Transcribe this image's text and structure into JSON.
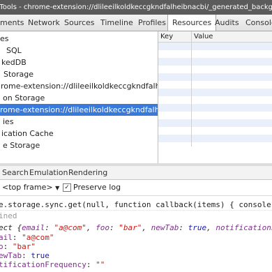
{
  "window": {
    "title": "r Tools - chrome-extension://dlileeilkoldkeccgkndfalheibnacbi/_generated_background_page.html"
  },
  "tabs": [
    {
      "label": "ments",
      "selected": false
    },
    {
      "label": "Network",
      "selected": false
    },
    {
      "label": "Sources",
      "selected": false
    },
    {
      "label": "Timeline",
      "selected": false
    },
    {
      "label": "Profiles",
      "selected": false
    },
    {
      "label": "Resources",
      "selected": true
    },
    {
      "label": "Audits",
      "selected": false
    },
    {
      "label": "Console",
      "selected": false
    }
  ],
  "sidebar": {
    "items": [
      {
        "label": "es",
        "selected": false
      },
      {
        "label": "SQL",
        "selected": false
      },
      {
        "label": "kedDB",
        "selected": false
      },
      {
        "label": "Storage",
        "selected": false
      },
      {
        "label": "rome-extension://dlileeilkoldkeccgkndfalheibn...",
        "selected": false
      },
      {
        "label": "on Storage",
        "selected": false
      },
      {
        "label": "rome-extension://dlileeilkoldkeccgkndfalheibn...",
        "selected": true
      },
      {
        "label": "ies",
        "selected": false
      },
      {
        "label": "ication Cache",
        "selected": false
      },
      {
        "label": "e Storage",
        "selected": false
      }
    ]
  },
  "kv_table": {
    "key_header": "Key",
    "value_header": "Value",
    "refresh_icon": "refresh-icon"
  },
  "drawer": {
    "tabs": [
      {
        "label": "Search"
      },
      {
        "label": "Emulation"
      },
      {
        "label": "Rendering"
      }
    ]
  },
  "console_toolbar": {
    "frame_select": "<top frame>",
    "dropdown_glyph": "▼",
    "preserve_log_label": "Preserve log",
    "preserve_log_checked": true,
    "check_glyph": "✓"
  },
  "console": {
    "command": "e.storage.sync.get(null, function callback(items) { console.log(ite",
    "undefined_result": "ined",
    "object_summary": {
      "open": "ect {",
      "p1_key": "email",
      "p1_colon": ": ",
      "p1_val": "\"a@com\"",
      "sep1": ", ",
      "p2_key": "foo",
      "p2_colon": ": ",
      "p2_val": "\"bar\"",
      "sep2": ", ",
      "p3_key": "newTab",
      "p3_colon": ": ",
      "p3_val": "true",
      "sep3": ", ",
      "p4_key": "notificationFrequency"
    },
    "props": [
      {
        "key": "ail",
        "colon": ": ",
        "value": "\"a@com\"",
        "type": "str"
      },
      {
        "key": "o",
        "colon": ": ",
        "value": "\"bar\"",
        "type": "str"
      },
      {
        "key": "ewTab",
        "colon": ": ",
        "value": "true",
        "type": "kw"
      },
      {
        "key": "tificationFrequency",
        "colon": ": ",
        "value": "\"\"",
        "type": "str"
      }
    ]
  }
}
